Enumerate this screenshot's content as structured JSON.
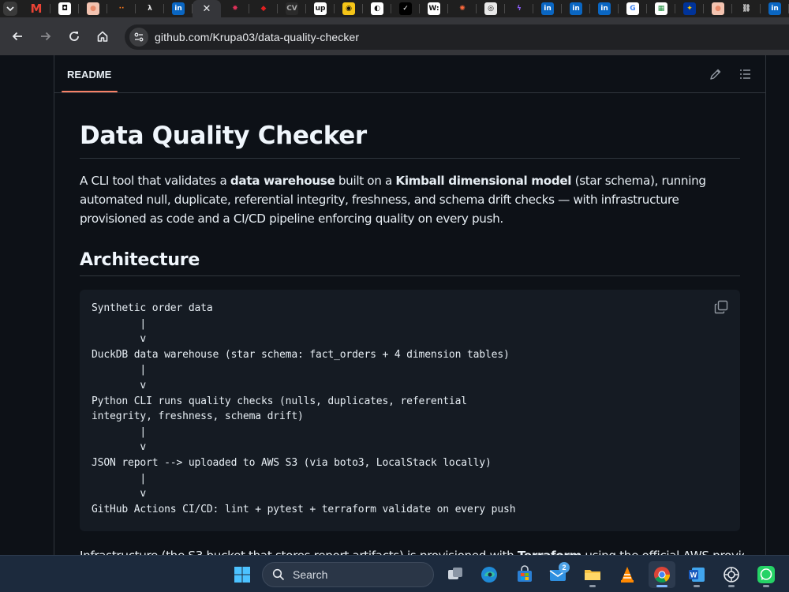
{
  "browser": {
    "tabs": [
      {
        "name": "tab-gmail",
        "icon": "gmail-icon",
        "glyph": "M",
        "color": "#ea4335",
        "bg": "transparent"
      },
      {
        "name": "tab-2",
        "icon": "app-icon",
        "glyph": "◘",
        "color": "#111111",
        "bg": "#ffffff"
      },
      {
        "name": "tab-3",
        "icon": "avatar-icon",
        "glyph": "●",
        "color": "#e88b6b",
        "bg": "#f3c3b0"
      },
      {
        "name": "tab-4",
        "icon": "dots-icon",
        "glyph": "··",
        "color": "#ff7a1a",
        "bg": "transparent"
      },
      {
        "name": "tab-5",
        "icon": "lambda-icon",
        "glyph": "λ",
        "color": "#e8e8e8",
        "bg": "transparent"
      },
      {
        "name": "tab-linkedin-1",
        "icon": "linkedin-icon",
        "glyph": "in",
        "color": "#ffffff",
        "bg": "#0a66c2"
      },
      {
        "name": "tab-active",
        "icon": "close-icon",
        "glyph": "✕",
        "color": "#e8eaed",
        "bg": "transparent",
        "active": true
      },
      {
        "name": "tab-8",
        "icon": "jester-icon",
        "glyph": "✸",
        "color": "#e0315a",
        "bg": "transparent"
      },
      {
        "name": "tab-9",
        "icon": "red-shape-icon",
        "glyph": "◆",
        "color": "#e02020",
        "bg": "transparent"
      },
      {
        "name": "tab-10",
        "icon": "cv-icon",
        "glyph": "CV",
        "color": "#aaaaaa",
        "bg": "#2a2a2a"
      },
      {
        "name": "tab-upwork",
        "icon": "upwork-icon",
        "glyph": "up",
        "color": "#111111",
        "bg": "#ffffff"
      },
      {
        "name": "tab-12",
        "icon": "honey-icon",
        "glyph": "◉",
        "color": "#111111",
        "bg": "#f5c518"
      },
      {
        "name": "tab-13",
        "icon": "circle-icon",
        "glyph": "◐",
        "color": "#111111",
        "bg": "#ffffff"
      },
      {
        "name": "tab-14",
        "icon": "check-icon",
        "glyph": "✓",
        "color": "#ffffff",
        "bg": "#000000"
      },
      {
        "name": "tab-15",
        "icon": "w-icon",
        "glyph": "W:",
        "color": "#111111",
        "bg": "#ffffff"
      },
      {
        "name": "tab-16",
        "icon": "burst-icon",
        "glyph": "✺",
        "color": "#ff6a3d",
        "bg": "transparent"
      },
      {
        "name": "tab-17",
        "icon": "openai-icon",
        "glyph": "◎",
        "color": "#111111",
        "bg": "#e8e8e8"
      },
      {
        "name": "tab-18",
        "icon": "bolt-icon",
        "glyph": "ϟ",
        "color": "#8b5cf6",
        "bg": "transparent"
      },
      {
        "name": "tab-linkedin-2",
        "icon": "linkedin-icon",
        "glyph": "in",
        "color": "#ffffff",
        "bg": "#0a66c2"
      },
      {
        "name": "tab-linkedin-3",
        "icon": "linkedin-icon",
        "glyph": "in",
        "color": "#ffffff",
        "bg": "#0a66c2"
      },
      {
        "name": "tab-linkedin-4",
        "icon": "linkedin-icon",
        "glyph": "in",
        "color": "#ffffff",
        "bg": "#0a66c2"
      },
      {
        "name": "tab-google",
        "icon": "google-icon",
        "glyph": "G",
        "color": "#4285f4",
        "bg": "#ffffff"
      },
      {
        "name": "tab-23",
        "icon": "sheets-icon",
        "glyph": "▦",
        "color": "#1e8e3e",
        "bg": "#ffffff"
      },
      {
        "name": "tab-24",
        "icon": "eu-icon",
        "glyph": "✦",
        "color": "#ffcc00",
        "bg": "#003399"
      },
      {
        "name": "tab-25",
        "icon": "avatar-icon",
        "glyph": "●",
        "color": "#e88b6b",
        "bg": "#f3c3b0"
      },
      {
        "name": "tab-26",
        "icon": "link-icon",
        "glyph": "⛓",
        "color": "#c8c8c8",
        "bg": "transparent"
      },
      {
        "name": "tab-linkedin-5",
        "icon": "linkedin-icon",
        "glyph": "in",
        "color": "#ffffff",
        "bg": "#0a66c2"
      }
    ],
    "url": "github.com/Krupa03/data-quality-checker"
  },
  "readme": {
    "tab_label": "README",
    "title": "Data Quality Checker",
    "intro": {
      "p1": "A CLI tool that validates a ",
      "b1": "data warehouse",
      "p2": " built on a ",
      "b2": "Kimball dimensional model",
      "p3": " (star schema), running automated null, duplicate, referential integrity, freshness, and schema drift checks — with infrastructure provisioned as code and a CI/CD pipeline enforcing quality on every push."
    },
    "architecture_heading": "Architecture",
    "code": "Synthetic order data\n        |\n        v\nDuckDB data warehouse (star schema: fact_orders + 4 dimension tables)\n        |\n        v\nPython CLI runs quality checks (nulls, duplicates, referential\nintegrity, freshness, schema drift)\n        |\n        v\nJSON report --> uploaded to AWS S3 (via boto3, LocalStack locally)\n        |\n        v\nGitHub Actions CI/CD: lint + pytest + terraform validate on every push",
    "cut_line": {
      "p1": "Infrastructure (the S3 bucket that stores report artifacts) is provisioned with ",
      "b1": "Terraform",
      "p2": " using the official AWS provider."
    }
  },
  "taskbar": {
    "search_label": "Search",
    "mail_badge": "2"
  }
}
